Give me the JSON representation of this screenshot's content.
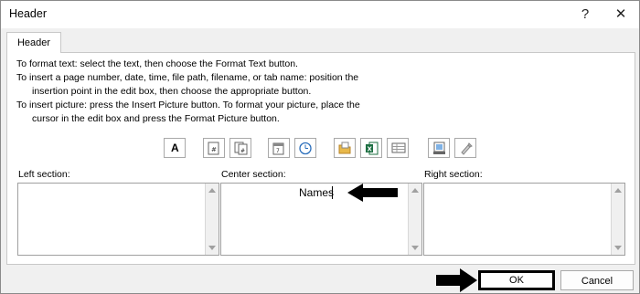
{
  "window": {
    "title": "Header",
    "help_glyph": "?",
    "close_glyph": "✕"
  },
  "tab": {
    "label": "Header"
  },
  "instructions": [
    "To format text:  select the text, then choose the Format Text button.",
    "To insert a page number, date, time, file path, filename, or tab name:  position the",
    "insertion point in the edit box, then choose the appropriate button.",
    "To insert picture: press the Insert Picture button.  To format your picture, place the",
    "cursor in the edit box and press the Format Picture button."
  ],
  "toolbar": {
    "format_text_glyph": "A",
    "buttons": [
      "format-text",
      "insert-page-number",
      "insert-number-of-pages",
      "insert-date",
      "insert-time",
      "insert-file-path",
      "insert-file-name",
      "insert-sheet-name",
      "insert-picture",
      "format-picture"
    ]
  },
  "sections": {
    "left": {
      "label": "Left section:",
      "value": ""
    },
    "center": {
      "label": "Center section:",
      "value": "Names"
    },
    "right": {
      "label": "Right section:",
      "value": ""
    }
  },
  "buttons": {
    "ok": "OK",
    "cancel": "Cancel"
  },
  "annotations": {
    "arrow_color": "#000000"
  }
}
